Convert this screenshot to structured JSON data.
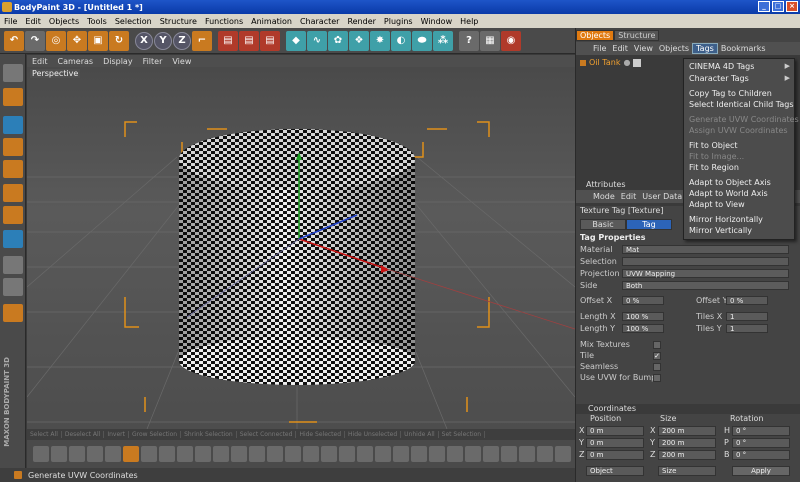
{
  "window": {
    "title": "BodyPaint 3D - [Untitled 1 *]"
  },
  "menubar": [
    "File",
    "Edit",
    "Objects",
    "Tools",
    "Selection",
    "Structure",
    "Functions",
    "Animation",
    "Character",
    "Render",
    "Plugins",
    "Window",
    "Help"
  ],
  "toolbar": {
    "axis_x": "X",
    "axis_y": "Y",
    "axis_z": "Z"
  },
  "viewport": {
    "menu": [
      "Edit",
      "Cameras",
      "Display",
      "Filter",
      "View"
    ],
    "label": "Perspective"
  },
  "selection_bar": [
    "Select All",
    "Deselect All",
    "Invert",
    "Grow Selection",
    "Shrink Selection",
    "Select Connected",
    "Hide Selected",
    "Hide Unselected",
    "Unhide All",
    "Set Selection"
  ],
  "branding": "MAXON BODYPAINT 3D",
  "status": "Generate UVW Coordinates",
  "objects_panel": {
    "tabs": [
      "Objects",
      "Structure"
    ],
    "active_tab": "Objects",
    "menu": [
      "File",
      "Edit",
      "View",
      "Objects",
      "Tags",
      "Bookmarks"
    ],
    "active_menu": "Tags",
    "object_name": "Oil Tank"
  },
  "tags_menu": {
    "items": [
      {
        "label": "CINEMA 4D Tags",
        "disabled": false,
        "submenu": true
      },
      {
        "label": "Character Tags",
        "disabled": false,
        "submenu": true
      },
      {
        "label": "Copy Tag to Children",
        "disabled": false
      },
      {
        "label": "Select Identical Child Tags",
        "disabled": false
      },
      {
        "label": "Generate UVW Coordinates",
        "disabled": true
      },
      {
        "label": "Assign UVW Coordinates",
        "disabled": true
      },
      {
        "label": "Fit to Object",
        "disabled": false
      },
      {
        "label": "Fit to Image...",
        "disabled": true
      },
      {
        "label": "Fit to Region",
        "disabled": false
      },
      {
        "label": "Adapt to Object Axis",
        "disabled": false
      },
      {
        "label": "Adapt to World Axis",
        "disabled": false
      },
      {
        "label": "Adapt to View",
        "disabled": false
      },
      {
        "label": "Mirror Horizontally",
        "disabled": false
      },
      {
        "label": "Mirror Vertically",
        "disabled": false
      }
    ]
  },
  "attributes": {
    "header": "Attributes",
    "menu": [
      "Mode",
      "Edit",
      "User Data"
    ],
    "tag_title": "Texture Tag [Texture]",
    "subtabs": [
      "Basic",
      "Tag"
    ],
    "active_subtab": "Tag",
    "section": "Tag Properties",
    "material_label": "Material",
    "material_value": "Mat",
    "selection_label": "Selection",
    "selection_value": "",
    "projection_label": "Projection",
    "projection_value": "UVW Mapping",
    "side_label": "Side",
    "side_value": "Both",
    "offset_x_label": "Offset X",
    "offset_x_value": "0 %",
    "offset_y_label": "Offset Y",
    "offset_y_value": "0 %",
    "length_x_label": "Length X",
    "length_x_value": "100 %",
    "length_y_label": "Length Y",
    "length_y_value": "100 %",
    "tiles_x_label": "Tiles X",
    "tiles_x_value": "1",
    "tiles_y_label": "Tiles Y",
    "tiles_y_value": "1",
    "mix_textures_label": "Mix Textures",
    "mix_textures": false,
    "tile_label": "Tile",
    "tile": true,
    "seamless_label": "Seamless",
    "seamless": false,
    "use_uvw_bump_label": "Use UVW for Bump",
    "use_uvw_bump": false
  },
  "coordinates": {
    "header": "Coordinates",
    "col_position": "Position",
    "col_size": "Size",
    "col_rotation": "Rotation",
    "rows": [
      {
        "axis": "X",
        "pos": "0 m",
        "size_axis": "X",
        "size": "200 m",
        "rot_axis": "H",
        "rot": "0 °"
      },
      {
        "axis": "Y",
        "pos": "0 m",
        "size_axis": "Y",
        "size": "200 m",
        "rot_axis": "P",
        "rot": "0 °"
      },
      {
        "axis": "Z",
        "pos": "0 m",
        "size_axis": "Z",
        "size": "200 m",
        "rot_axis": "B",
        "rot": "0 °"
      }
    ],
    "mode_dropdown": "Object",
    "size_dropdown": "Size",
    "apply_label": "Apply"
  },
  "colors": {
    "accent_orange": "#e07a10",
    "selection_blue": "#2c64b8",
    "background": "#444444"
  }
}
